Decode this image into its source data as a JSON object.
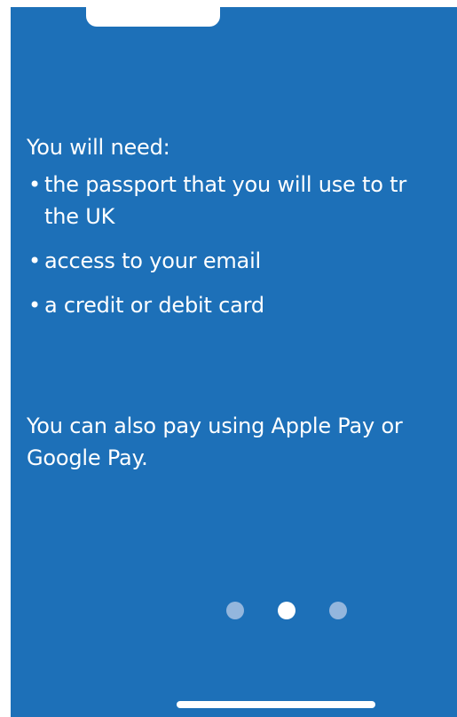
{
  "intro": {
    "heading": "You will need:",
    "bullets": [
      {
        "marker": "•",
        "line1": "the passport that you will use to tr",
        "line2": "the UK"
      },
      {
        "marker": "•",
        "line1": "access to your email"
      },
      {
        "marker": "•",
        "line1": "a credit or debit card"
      }
    ]
  },
  "payment_note": {
    "line1": "You can also pay using Apple Pay or",
    "line2": "Google Pay."
  },
  "pager": {
    "total": 3,
    "active_index": 1
  },
  "colors": {
    "background": "#1d70b8",
    "text": "#ffffff",
    "dot_inactive": "#93b6dd",
    "dot_active": "#ffffff"
  }
}
